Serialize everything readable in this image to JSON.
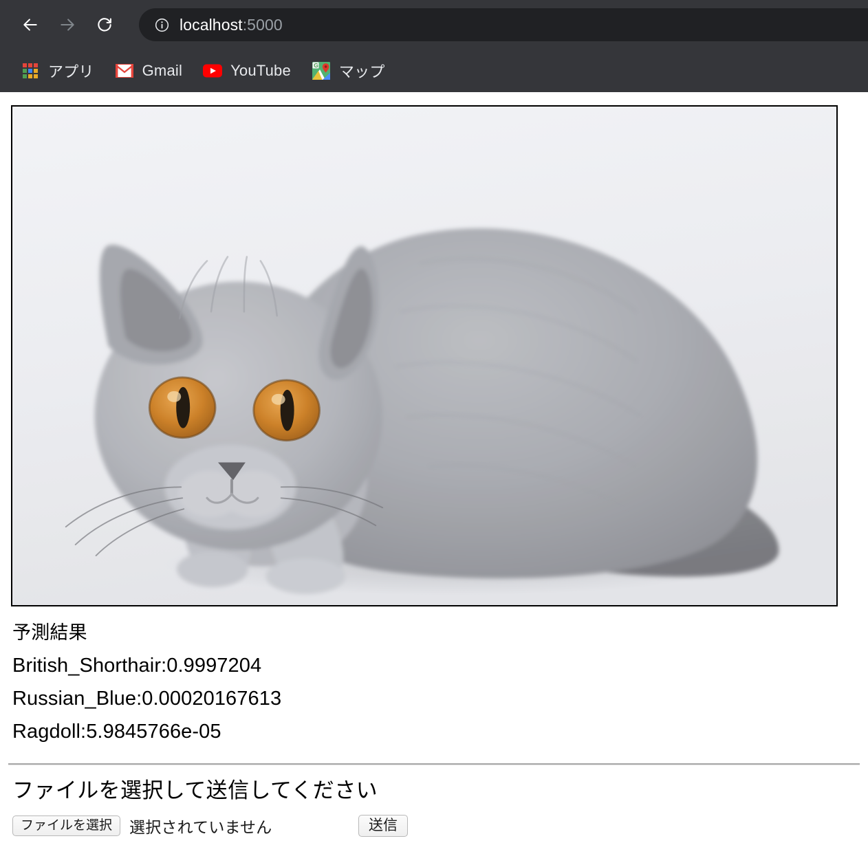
{
  "browser": {
    "nav": {
      "back_label": "Back",
      "forward_label": "Forward",
      "reload_label": "Reload"
    },
    "omnibox": {
      "site_info_icon": "info-circle-icon",
      "host": "localhost",
      "port": ":5000",
      "full_url": "localhost:5000"
    },
    "bookmarks": [
      {
        "label": "アプリ",
        "icon": "apps-grid-icon"
      },
      {
        "label": "Gmail",
        "icon": "gmail-icon"
      },
      {
        "label": "YouTube",
        "icon": "youtube-icon"
      },
      {
        "label": "マップ",
        "icon": "google-maps-icon"
      }
    ]
  },
  "page": {
    "image": {
      "alt": "British Shorthair cat",
      "subject": "gray British Shorthair cat sitting, amber eyes, light gray studio background"
    },
    "result": {
      "heading": "予測結果",
      "predictions": [
        {
          "label": "British_Shorthair",
          "score": "0.9997204",
          "line": "British_Shorthair:0.9997204"
        },
        {
          "label": "Russian_Blue",
          "score": "0.00020167613",
          "line": "Russian_Blue:0.00020167613"
        },
        {
          "label": "Ragdoll",
          "score": "5.9845766e-05",
          "line": "Ragdoll:5.9845766e-05"
        }
      ]
    },
    "form": {
      "title": "ファイルを選択して送信してください",
      "choose_file_label": "ファイルを選択",
      "no_file_text": "選択されていません",
      "submit_label": "送信"
    }
  },
  "colors": {
    "chrome_bg": "#35363a",
    "omnibox_bg": "#202124",
    "chrome_text": "#e8eaed",
    "url_port": "#9aa0a6",
    "page_bg": "#ffffff",
    "image_border": "#000000",
    "divider": "#a9a9a9",
    "gmail_red": "#e7453c",
    "youtube_red": "#ff0000",
    "apps_red": "#e4453a",
    "apps_green": "#4e9f52",
    "apps_blue": "#3b86f7",
    "apps_yellow": "#e8aa28",
    "maps_green": "#52b272",
    "maps_blue": "#4b8df8",
    "maps_pin_red": "#e0392b",
    "cat_fur": "#a6a8ad",
    "cat_eye": "#cb7a1e"
  }
}
